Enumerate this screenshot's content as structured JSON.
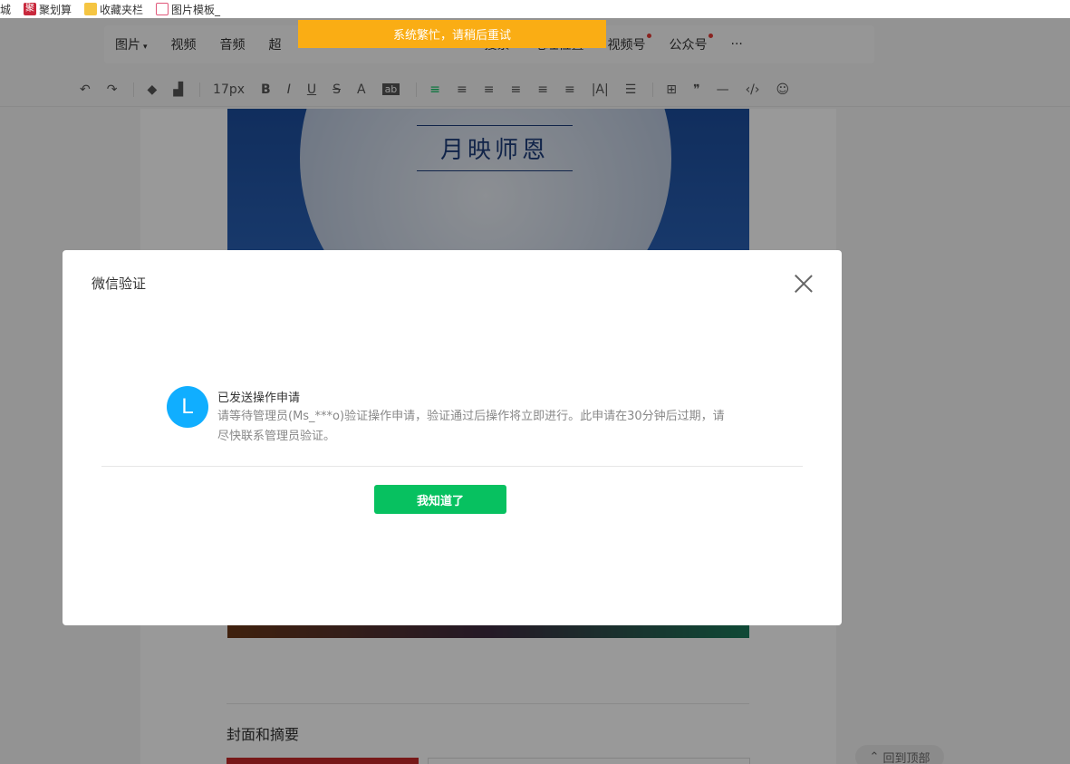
{
  "bookmarks": {
    "items": [
      {
        "label": "城",
        "icon": "none"
      },
      {
        "label": "聚划算",
        "icon": "juhuasuan-icon",
        "glyph": "聚"
      },
      {
        "label": "收藏夹栏",
        "icon": "folder-icon"
      },
      {
        "label": "图片模板_",
        "icon": "image-icon",
        "glyph": "图"
      }
    ]
  },
  "toast": {
    "text": "系统繁忙，请稍后重试",
    "color": "#faad14"
  },
  "insert_bar": {
    "items": [
      {
        "label": "图片",
        "caret": "▾"
      },
      {
        "label": "视频"
      },
      {
        "label": "音频"
      },
      {
        "label": "超"
      },
      {
        "label": ""
      },
      {
        "label": ""
      },
      {
        "label": ""
      },
      {
        "label": "搜索"
      },
      {
        "label": "地理位置"
      },
      {
        "label": "视频号",
        "dot": true
      },
      {
        "label": "公众号",
        "dot": true
      },
      {
        "label": "···"
      }
    ]
  },
  "format_bar": {
    "undo_icon": "↶",
    "redo_icon": "↷",
    "font_size": "17px",
    "bold": "B",
    "italic": "I",
    "underline": "U",
    "strike": "S",
    "font_color": "A",
    "bg_color": "ab",
    "quote": "❞",
    "hr": "—",
    "code": "‹/›",
    "emoji": "☺"
  },
  "cover": {
    "title": "月映师恩"
  },
  "summary": {
    "title": "封面和摘要"
  },
  "back_to_top": {
    "label": "回到顶部",
    "icon": "⌃"
  },
  "dialog": {
    "title": "微信验证",
    "avatar_letter": "L",
    "message_title": "已发送操作申请",
    "message_desc": "请等待管理员(Ms_***o)验证操作申请，验证通过后操作将立即进行。此申请在30分钟后过期，请尽快联系管理员验证。",
    "ok_label": "我知道了",
    "ok_color": "#07c160",
    "avatar_color": "#10aeff"
  }
}
